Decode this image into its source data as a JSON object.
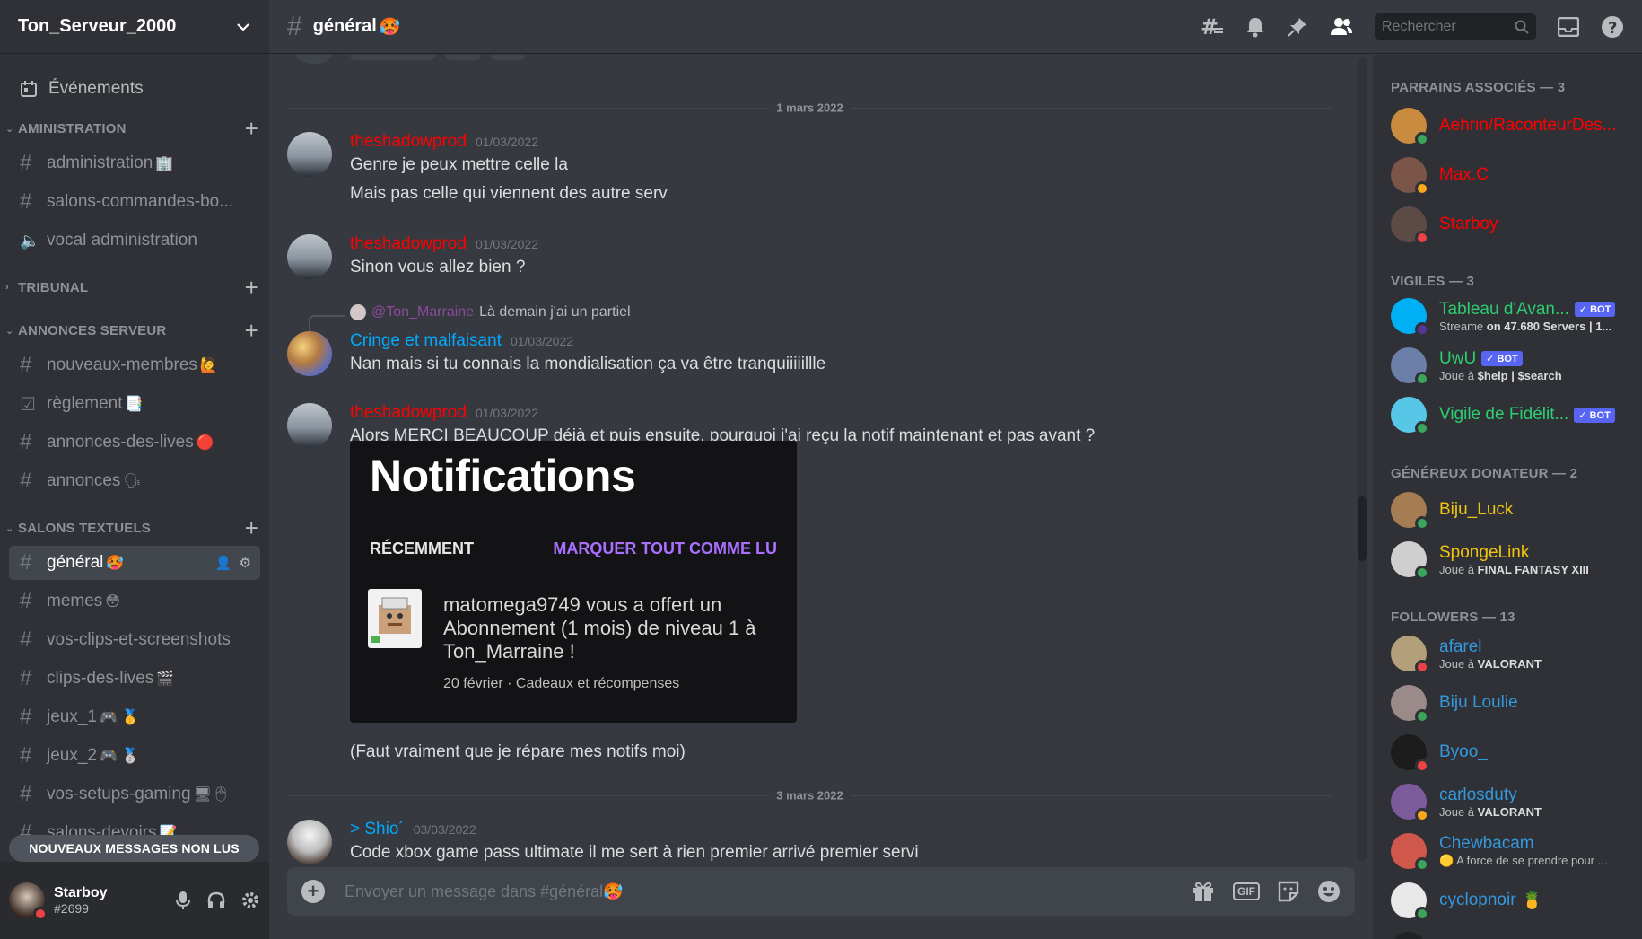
{
  "server": {
    "name": "Ton_Serveur_2000"
  },
  "sidebar": {
    "events_label": "Événements",
    "categories": [
      {
        "name": "AMINISTRATION",
        "channels": [
          {
            "name": "administration",
            "emoji": "🏢",
            "type": "text-locked"
          },
          {
            "name": "salons-commandes-bo...",
            "emoji": "",
            "type": "text-locked"
          },
          {
            "name": "vocal administration",
            "emoji": "",
            "type": "voice-locked"
          }
        ]
      },
      {
        "name": "TRIBUNAL",
        "collapsed": true,
        "channels": []
      },
      {
        "name": "ANNONCES SERVEUR",
        "channels": [
          {
            "name": "nouveaux-membres",
            "emoji": "🙋",
            "type": "text"
          },
          {
            "name": "règlement",
            "emoji": "📑",
            "type": "rules"
          },
          {
            "name": "annonces-des-lives",
            "emoji": "🔴",
            "type": "text"
          },
          {
            "name": "annonces",
            "emoji": "🗣",
            "type": "text"
          }
        ]
      },
      {
        "name": "SALONS TEXTUELS",
        "channels": [
          {
            "name": "général",
            "emoji": "🥵",
            "type": "text",
            "active": true
          },
          {
            "name": "memes",
            "emoji": "😳",
            "type": "text"
          },
          {
            "name": "vos-clips-et-screenshots",
            "emoji": "",
            "type": "text"
          },
          {
            "name": "clips-des-lives",
            "emoji": "🎬",
            "type": "text"
          },
          {
            "name": "jeux_1",
            "emoji": "🎮 🥇",
            "type": "text"
          },
          {
            "name": "jeux_2",
            "emoji": "🎮 🥈",
            "type": "text"
          },
          {
            "name": "vos-setups-gaming",
            "emoji": "🖥🖱",
            "type": "text"
          },
          {
            "name": "salons-devoirs",
            "emoji": "📝",
            "type": "text"
          }
        ]
      }
    ],
    "unread_banner": "NOUVEAUX MESSAGES NON LUS"
  },
  "user": {
    "name": "Starboy",
    "tag": "#2699",
    "status_color": "#ed4245"
  },
  "topbar": {
    "channel": "général",
    "channel_emoji": "🥵",
    "search_placeholder": "Rechercher"
  },
  "chat": {
    "dividers": [
      "1 mars 2022",
      "3 mars 2022"
    ],
    "messages": [
      {
        "author": "theshadowprod",
        "color": "#ff0000",
        "timestamp": "01/03/2022",
        "lines": [
          "Genre je peux mettre celle la",
          "Mais pas celle qui viennent des autre serv"
        ]
      },
      {
        "author": "theshadowprod",
        "color": "#ff0000",
        "timestamp": "01/03/2022",
        "lines": [
          "Sinon vous allez bien ?"
        ]
      },
      {
        "author": "Cringe et malfaisant",
        "color": "#00aaff",
        "timestamp": "01/03/2022",
        "reply_to": "@Ton_Marraine",
        "reply_text": "Là demain j'ai un partiel",
        "lines": [
          "Nan mais si tu connais la mondialisation ça va être tranquiiiiillle"
        ]
      },
      {
        "author": "theshadowprod",
        "color": "#ff0000",
        "timestamp": "01/03/2022",
        "lines": [
          "Alors MERCI BEAUCOUP déjà et puis ensuite, pourquoi j'ai reçu la notif maintenant et pas avant ?"
        ],
        "after": "(Faut vraiment que je répare mes notifs moi)"
      },
      {
        "author": "> Shio´",
        "color": "#00aaff",
        "timestamp": "03/03/2022",
        "lines": [
          "Code xbox game pass ultimate il me sert à rien premier arrivé premier servi"
        ]
      }
    ],
    "attachment": {
      "title": "Notifications",
      "recent": "RÉCEMMENT",
      "mark_all": "MARQUER TOUT COMME LU",
      "text": "matomega9749 vous a offert un Abonnement (1 mois) de niveau 1 à Ton_Marraine !",
      "meta": "20 février · Cadeaux et récompenses"
    }
  },
  "composer": {
    "placeholder": "Envoyer un message dans #général🥵",
    "gif_label": "GIF"
  },
  "members": {
    "groups": [
      {
        "title": "PARRAINS ASSOCIÉS — 3",
        "members": [
          {
            "name": "Aehrin/RaconteurDes...",
            "color": "#ff0000",
            "status": "#3ba55c",
            "avatar": "#c98b3f"
          },
          {
            "name": "Max.C",
            "color": "#ff0000",
            "status": "#faa81a",
            "avatar": "#7a5548"
          },
          {
            "name": "Starboy",
            "color": "#ff0000",
            "status": "#ed4245",
            "avatar": "#5b4a46"
          }
        ]
      },
      {
        "title": "VIGILES — 3",
        "members": [
          {
            "name": "Tableau d'Avan...",
            "color": "#2ecc71",
            "bot": "✓ BOT",
            "activity_prefix": "Streame",
            "activity": "on 47.680 Servers | 1...",
            "status": "#593695",
            "avatar": "#00b0f4"
          },
          {
            "name": "UwU",
            "color": "#2ecc71",
            "bot": "✓ BOT",
            "activity_prefix": "Joue à",
            "activity": "$help | $search",
            "status": "#3ba55c",
            "avatar": "#6b7fa8"
          },
          {
            "name": "Vigile de Fidélit...",
            "color": "#2ecc71",
            "bot": "✓ BOT",
            "status": "#3ba55c",
            "avatar": "#57c7e8"
          }
        ]
      },
      {
        "title": "GÉNÉREUX DONATEUR — 2",
        "members": [
          {
            "name": "Biju_Luck",
            "color": "#f1c40f",
            "status": "#3ba55c",
            "avatar": "#a67c52"
          },
          {
            "name": "SpongeLink",
            "color": "#f1c40f",
            "activity_prefix": "Joue à",
            "activity": "FINAL FANTASY XIII",
            "status": "#3ba55c",
            "avatar": "#cfcfcf"
          }
        ]
      },
      {
        "title": "FOLLOWERS — 13",
        "members": [
          {
            "name": "afarel",
            "color": "#3498db",
            "activity_prefix": "Joue à",
            "activity": "VALORANT",
            "status": "#ed4245",
            "avatar": "#b3a07a"
          },
          {
            "name": "Biju Loulie",
            "color": "#3498db",
            "status": "#3ba55c",
            "avatar": "#9b8a8a"
          },
          {
            "name": "Byoo_",
            "color": "#3498db",
            "status": "#ed4245",
            "avatar": "#1c1c1c"
          },
          {
            "name": "carlosduty",
            "color": "#3498db",
            "activity_prefix": "Joue à",
            "activity": "VALORANT",
            "status": "#faa81a",
            "avatar": "#7d5a9b"
          },
          {
            "name": "Chewbacam",
            "color": "#3498db",
            "activity": "🟡 A force de se prendre pour ...",
            "status": "#3ba55c",
            "avatar": "#d0574c"
          },
          {
            "name": "cyclopnoir",
            "color": "#3498db",
            "emoji": "🍍",
            "status": "#3ba55c",
            "avatar": "#e8e8e8"
          }
        ]
      }
    ]
  }
}
